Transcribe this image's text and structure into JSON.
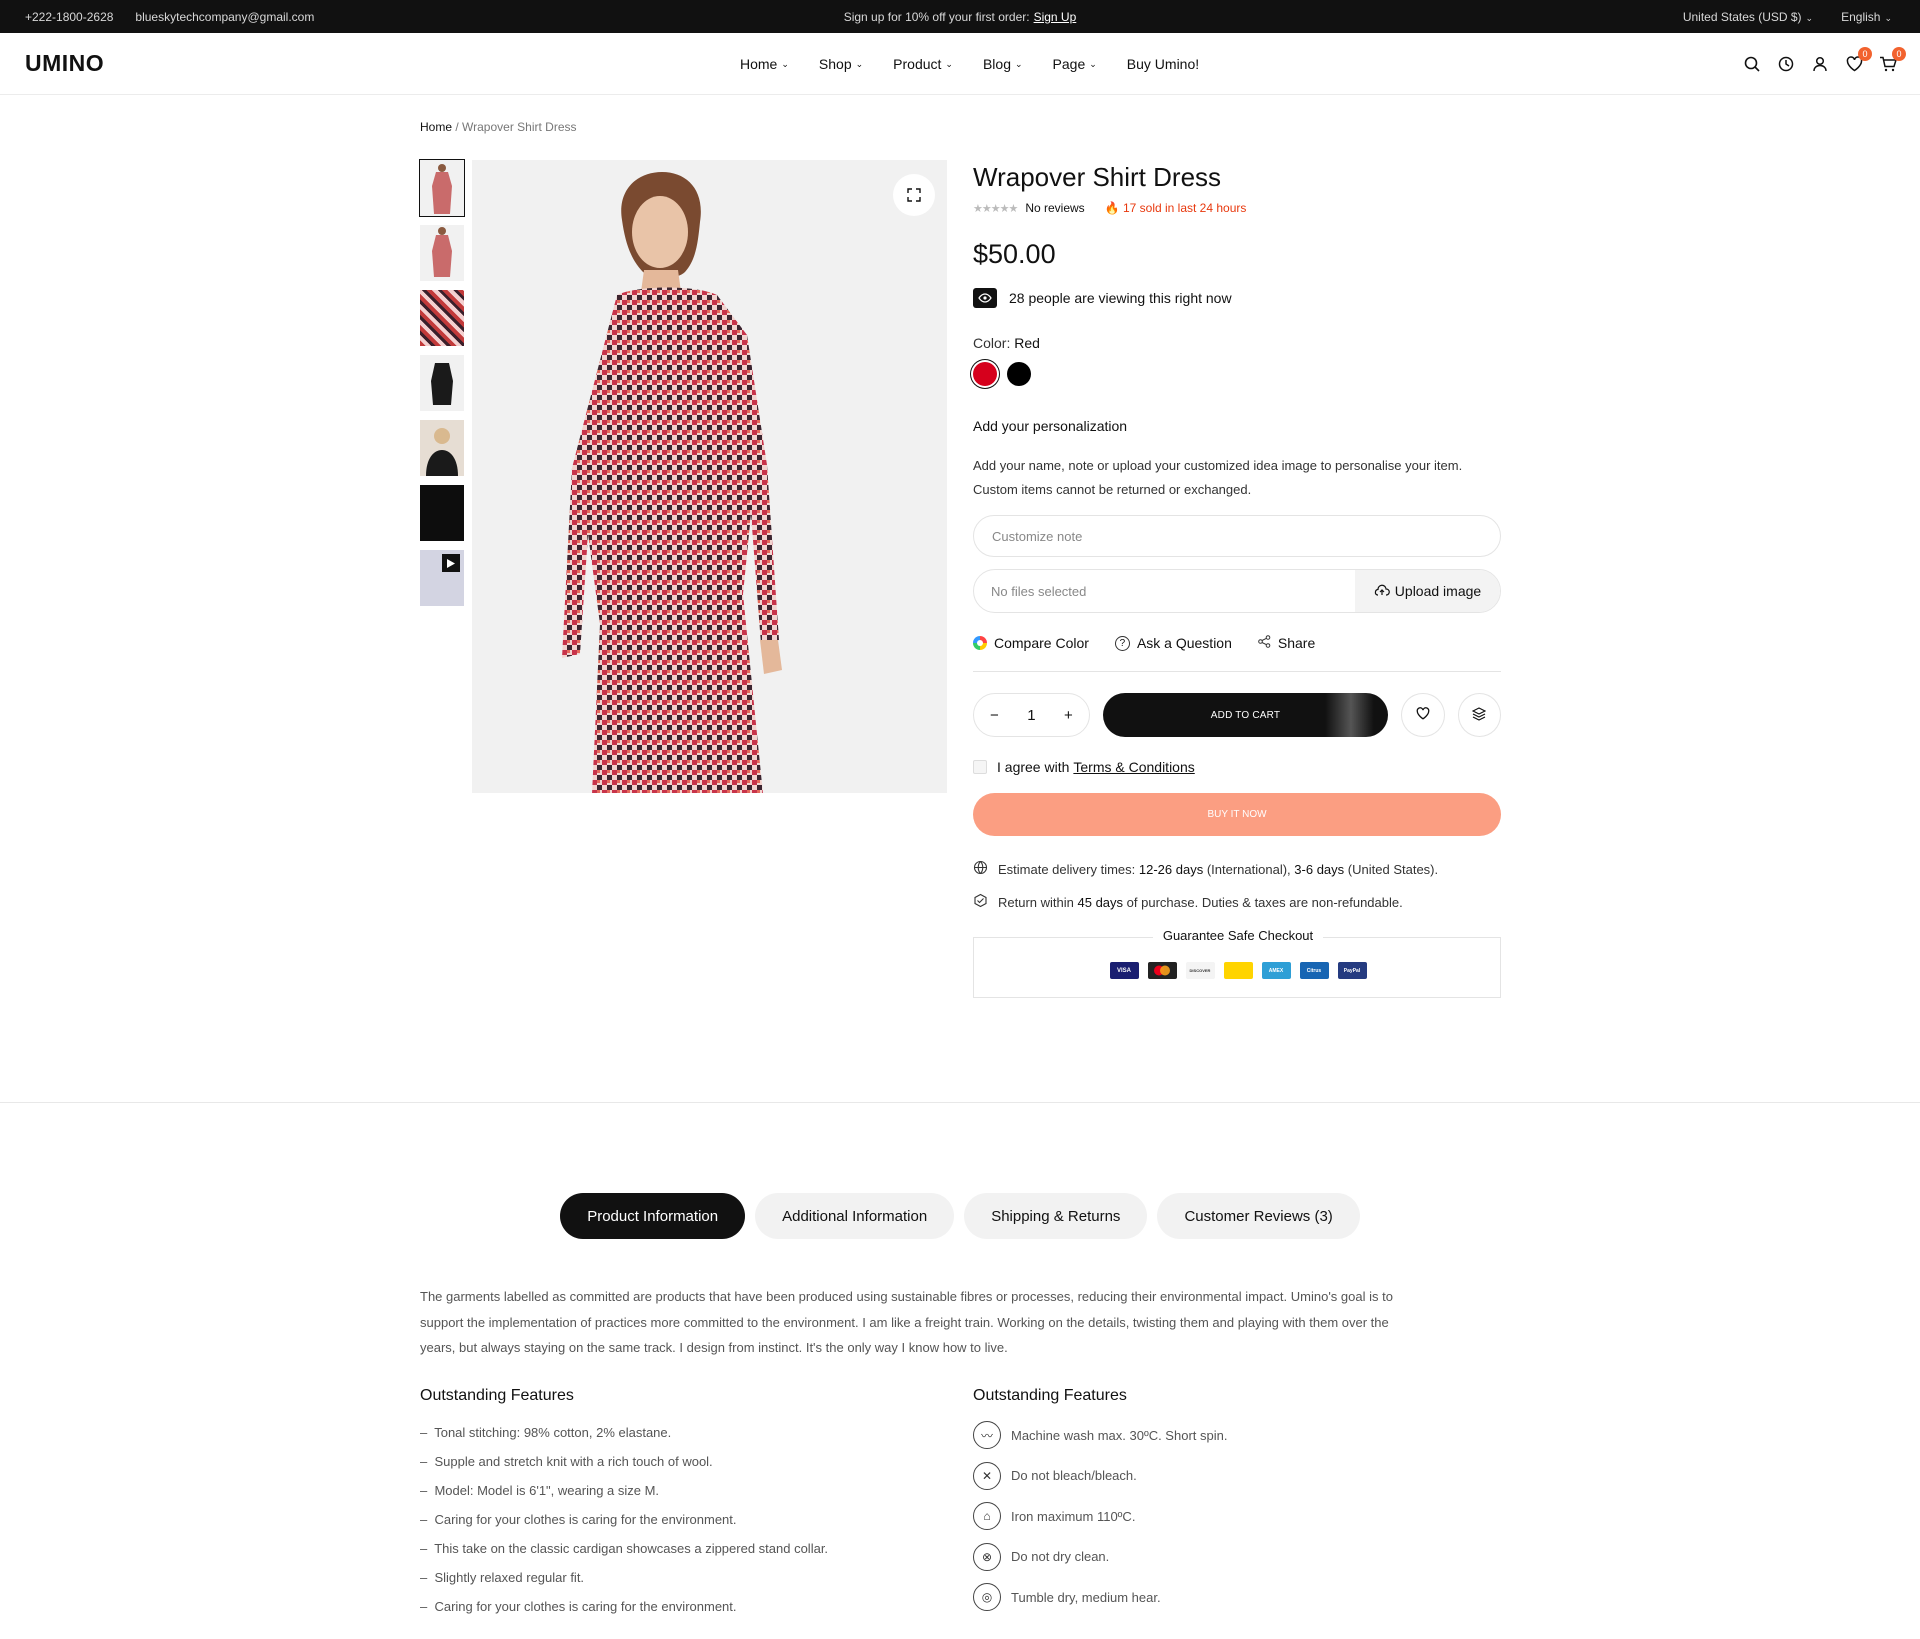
{
  "topbar": {
    "phone": "+222-1800-2628",
    "email": "blueskytechcompany@gmail.com",
    "promo": "Sign up for 10% off your first order:",
    "promo_link": "Sign Up",
    "currency": "United States (USD $)",
    "language": "English"
  },
  "header": {
    "logo": "UMINO",
    "nav": [
      "Home",
      "Shop",
      "Product",
      "Blog",
      "Page",
      "Buy Umino!"
    ],
    "wishlist_count": "0",
    "cart_count": "0"
  },
  "breadcrumb": {
    "home": "Home",
    "current": "Wrapover Shirt Dress"
  },
  "product": {
    "title": "Wrapover Shirt Dress",
    "reviews": "No reviews",
    "sold": "17 sold in last 24 hours",
    "price": "$50.00",
    "viewing": "28 people are viewing this right now",
    "color_label": "Color:",
    "color_value": "Red",
    "colors": [
      "#d6001c",
      "#000000"
    ],
    "personalization_title": "Add your personalization",
    "personalization_desc_1": "Add your name, note or upload your customized idea image to personalise your item.",
    "personalization_desc_2": "Custom items cannot be returned or exchanged.",
    "note_placeholder": "Customize note",
    "file_text": "No files selected",
    "upload_label": "Upload image",
    "compare_color": "Compare Color",
    "ask_question": "Ask a Question",
    "share": "Share",
    "quantity": "1",
    "add_to_cart": "ADD TO CART",
    "agree_text": "I agree with",
    "terms": "Terms & Conditions",
    "buy_now": "BUY IT NOW",
    "delivery_prefix": "Estimate delivery times:",
    "delivery_intl": "12-26 days",
    "delivery_intl_suffix": "(International),",
    "delivery_us": "3-6 days",
    "delivery_us_suffix": "(United States).",
    "return_prefix": "Return within",
    "return_days": "45 days",
    "return_suffix": "of purchase. Duties & taxes are non-refundable.",
    "guarantee": "Guarantee Safe Checkout",
    "payments": [
      "VISA",
      "MC",
      "DISCOVER",
      "BANK",
      "AMEX",
      "Citrus",
      "PayPal"
    ]
  },
  "tabs": [
    "Product Information",
    "Additional Information",
    "Shipping & Returns",
    "Customer Reviews (3)"
  ],
  "description": {
    "line1": "The garments labelled as committed are products that have been produced using sustainable fibres or processes, reducing their environmental impact. Umino's goal is to",
    "line2": "support the implementation of practices more committed to the environment. I am like a freight train. Working on the details, twisting them and playing with them over the",
    "line3": "years, but always staying on the same track. I design from instinct. It's the only way I know how to live."
  },
  "features_left": {
    "title": "Outstanding Features",
    "items": [
      "Tonal stitching: 98% cotton, 2% elastane.",
      "Supple and stretch knit with a rich touch of wool.",
      "Model:  Model is 6'1\", wearing a size M.",
      "Caring for your clothes is caring for the environment.",
      "This take on the classic cardigan showcases a zippered stand collar.",
      "Slightly relaxed regular fit.",
      "Caring for your clothes is caring for the environment."
    ]
  },
  "features_right": {
    "title": "Outstanding Features",
    "items": [
      "Machine wash max. 30ºC. Short spin.",
      "Do not bleach/bleach.",
      "Iron maximum 110ºC.",
      "Do not dry clean.",
      "Tumble dry, medium hear."
    ]
  }
}
